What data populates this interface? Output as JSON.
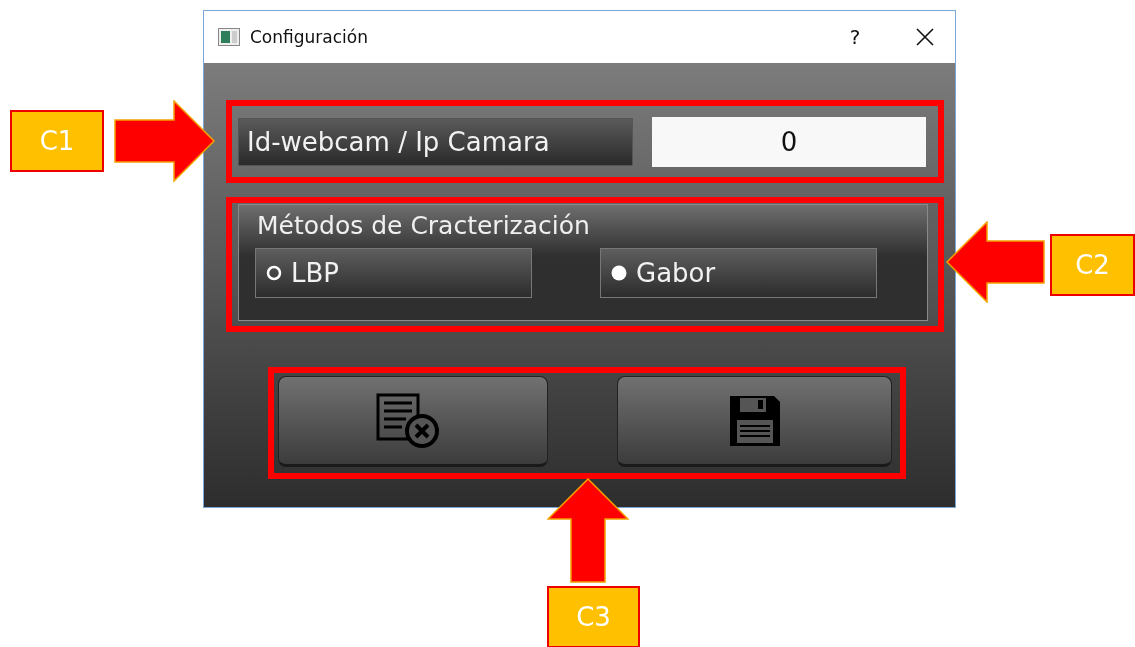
{
  "window": {
    "title": "Configuración",
    "help": "?"
  },
  "camera_field": {
    "label": "Id-webcam / Ip Camara",
    "value": "0"
  },
  "method_group": {
    "title": "Métodos de Cracterización",
    "options": [
      {
        "label": "LBP",
        "selected": false
      },
      {
        "label": "Gabor",
        "selected": true
      }
    ]
  },
  "callouts": [
    {
      "label": "C1"
    },
    {
      "label": "C2"
    },
    {
      "label": "C3"
    }
  ]
}
